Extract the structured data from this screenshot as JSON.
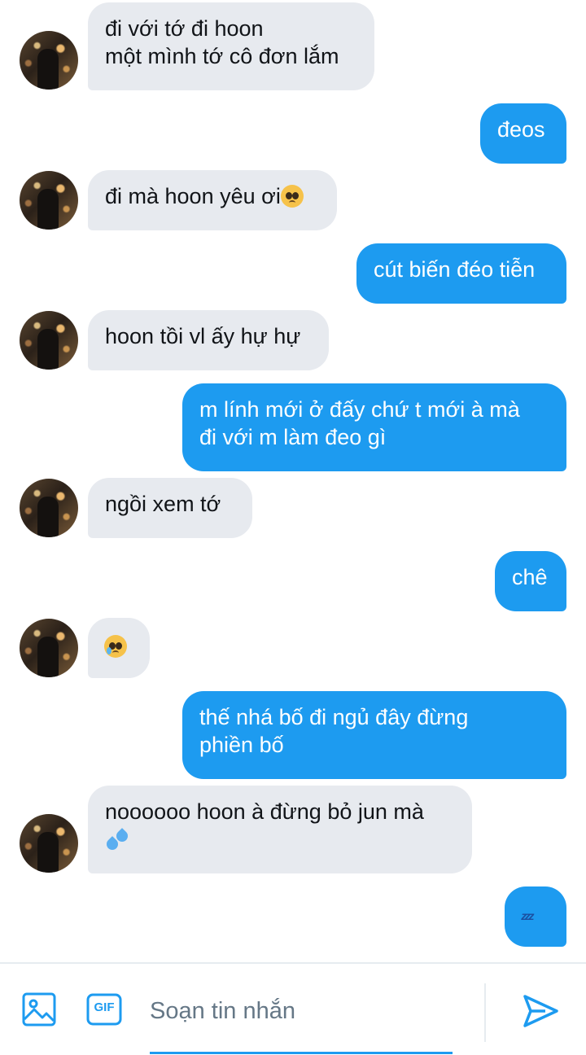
{
  "messages": [
    {
      "side": "in",
      "lines": [
        "đi với tớ đi hoon",
        "một mình tớ cô đơn lắm"
      ]
    },
    {
      "side": "out",
      "lines": [
        "đeos"
      ]
    },
    {
      "side": "in",
      "lines": [
        "đi mà hoon yêu ơi"
      ],
      "emoji": "pleading-face-emoji"
    },
    {
      "side": "out",
      "lines": [
        "cút biến đéo tiễn"
      ]
    },
    {
      "side": "in",
      "lines": [
        "hoon tồi vl ấy hự hự"
      ]
    },
    {
      "side": "out",
      "lines": [
        "m lính mới ở đấy chứ t mới à mà",
        "đi với m làm đeo gì"
      ]
    },
    {
      "side": "in",
      "lines": [
        "ngồi xem tớ"
      ]
    },
    {
      "side": "out",
      "lines": [
        "chê"
      ]
    },
    {
      "side": "in",
      "lines": [],
      "emoji": "crying-face-emoji"
    },
    {
      "side": "out",
      "lines": [
        "thế nhá bố đi ngủ đây đừng",
        "phiền bố"
      ]
    },
    {
      "side": "in",
      "lines": [
        "noooooo hoon à đừng bỏ jun mà"
      ],
      "emoji": "sweat-droplets-emoji"
    },
    {
      "side": "out",
      "lines": [],
      "emoji": "zzz-emoji"
    }
  ],
  "composer": {
    "placeholder": "Soạn tin nhắn",
    "gif_label": "GIF"
  },
  "colors": {
    "outgoing_bubble": "#1d9bf0",
    "incoming_bubble": "#e7eaef",
    "accent": "#1d9bf0"
  }
}
